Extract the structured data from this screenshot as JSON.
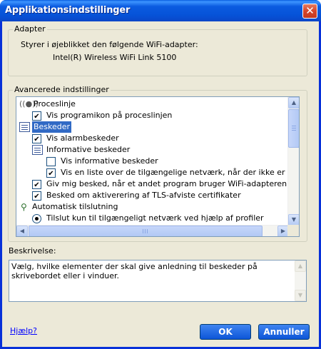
{
  "window": {
    "title": "Applikationsindstillinger"
  },
  "adapter": {
    "group_label": "Adapter",
    "description": "Styrer i øjeblikket den følgende WiFi-adapter:",
    "name": "Intel(R) Wireless WiFi Link 5100"
  },
  "advanced": {
    "group_label": "Avancerede indstillinger",
    "items": [
      {
        "label": "Proceslinje",
        "kind": "category",
        "icon": "wireless-icon"
      },
      {
        "label": "Vis programikon på proceslinjen",
        "kind": "checkbox",
        "checked": true
      },
      {
        "label": "Beskeder",
        "kind": "category",
        "icon": "list-icon",
        "selected": true
      },
      {
        "label": "Vis alarmbeskeder",
        "kind": "checkbox",
        "checked": true
      },
      {
        "label": "Informative beskeder",
        "kind": "category",
        "icon": "list-icon"
      },
      {
        "label": "Vis informative beskeder",
        "kind": "checkbox",
        "checked": false
      },
      {
        "label": "Vis en liste over de tilgængelige netværk, når der ikke er tilslutning.",
        "kind": "checkbox",
        "checked": true
      },
      {
        "label": "Giv mig besked, når et andet program bruger WiFi-adapteren.",
        "kind": "checkbox",
        "checked": true
      },
      {
        "label": "Besked om aktiverering af TLS-afviste certifikater",
        "kind": "checkbox",
        "checked": true
      },
      {
        "label": "Automatisk tilslutning",
        "kind": "category",
        "icon": "plug-icon"
      },
      {
        "label": "Tilslut kun til tilgængeligt netværk ved hjælp af profiler",
        "kind": "radio",
        "checked": true
      }
    ]
  },
  "description": {
    "label": "Beskrivelse:",
    "text": "Vælg, hvilke elementer der skal give anledning til beskeder på skrivebordet eller i vinduer."
  },
  "footer": {
    "help_link": "Hjælp?",
    "ok_label": "OK",
    "cancel_label": "Annuller"
  },
  "colors": {
    "title_bar": "#0a5fe0",
    "selection": "#316ac5",
    "dialog_bg": "#ece9d8",
    "button": "#0d56d8"
  }
}
